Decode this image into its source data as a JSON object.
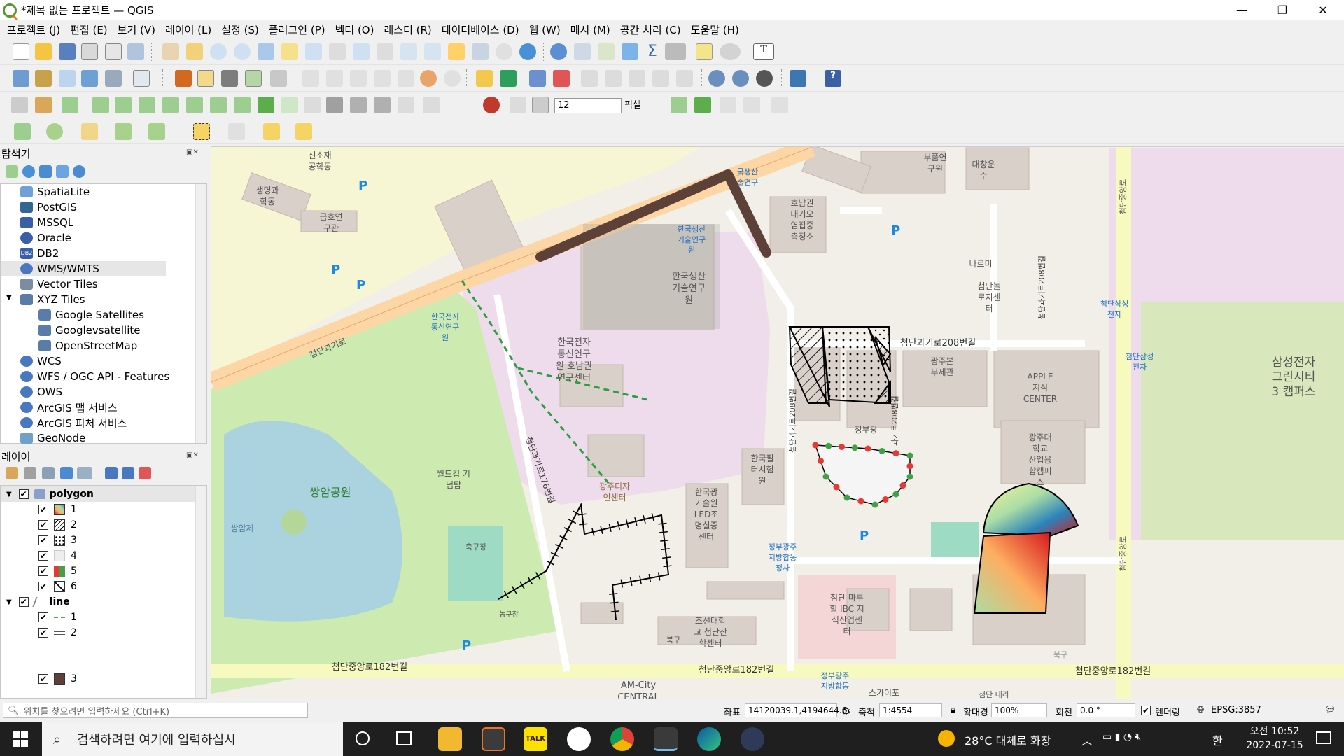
{
  "window": {
    "title": "*제목 없는 프로젝트 — QGIS",
    "minimize": "—",
    "maximize": "❐",
    "close": "✕"
  },
  "menu": [
    "프로젝트 (J)",
    "편집 (E)",
    "보기 (V)",
    "레이어 (L)",
    "설정 (S)",
    "플러그인 (P)",
    "벡터 (O)",
    "래스터 (R)",
    "데이터베이스 (D)",
    "웹 (W)",
    "메시 (M)",
    "공간 처리 (C)",
    "도움말 (H)"
  ],
  "digitize_toolbar": {
    "spin_value": "12",
    "unit": "픽셀"
  },
  "browser_panel": {
    "title": "탐색기",
    "items": [
      "SpatiaLite",
      "PostGIS",
      "MSSQL",
      "Oracle",
      "DB2",
      "WMS/WMTS",
      "Vector Tiles",
      "XYZ Tiles",
      "Google Satellites",
      "Googlevsatellite",
      "OpenStreetMap",
      "WCS",
      "WFS / OGC API - Features",
      "OWS",
      "ArcGIS 맵 서비스",
      "ArcGIS 피처 서비스",
      "GeoNode"
    ],
    "db2_badge": "DB2"
  },
  "layers_panel": {
    "title": "레이어",
    "polygon_layer": "polygon",
    "polygon_classes": [
      "1",
      "2",
      "3",
      "4",
      "5",
      "6"
    ],
    "line_layer": "line",
    "line_classes": [
      "1",
      "2"
    ],
    "extra_class": "3"
  },
  "locator": {
    "placeholder": "위치를 찾으려면 입력하세요 (Ctrl+K)"
  },
  "status": {
    "coord_label": "좌표",
    "coord_value": "14120039.1,4194644.6",
    "scale_label": "축척",
    "scale_value": "1:4554",
    "magnifier_label": "확대경",
    "magnifier_value": "100%",
    "rotation_label": "회전",
    "rotation_value": "0.0 °",
    "render_label": "렌더링",
    "crs": "EPSG:3857"
  },
  "map_labels": {
    "road_main": "첨단과기로",
    "road_182_left": "첨단중앙로182번길",
    "road_182_mid": "첨단중앙로182번길",
    "road_182_right": "첨단중앙로182번길",
    "road_208": "첨단과기로208번길",
    "road_208_v1": "첨단과기로208번길",
    "road_208_v2": "과기로208번길",
    "road_208_v3": "첨단과기로208번길",
    "road_176": "첨단과기로176번길",
    "road_jungang": "첨단중앙로",
    "road_jungang2": "첨단중앙로",
    "park": "쌍암공원",
    "pond": "쌍암제",
    "etri": "한국전자\n통신연구\n원 호남권\n연구센터",
    "etri_small": "한국전자\n통신연구\n원",
    "kitech": "한국생산\n기술연구\n원",
    "kitech_small": "한국생산\n기술연구\n원",
    "kitech_top": "국생산\n술연구",
    "samsung": "삼성전자\n그린시티\n3 캠퍼스",
    "samsung_bus1": "첨단삼성\n전자",
    "samsung_bus2": "첨단삼성\n전자",
    "apple": "APPLE\n지식\nCENTER",
    "gwangju_univ": "광주대\n학교\n산업용\n합캠퍼\n스",
    "gwangju_bon": "광주본\n부세관",
    "nano": "나르미",
    "nano2": "첨단놀\n로지센\n터",
    "honam_air": "호남권\n대기오\n염집중\n측정소",
    "daechang": "대창운\n수",
    "bupum": "부품연\n구원",
    "test_lab": "한국필\n터시험\n원",
    "led": "한국광\n기술원\nLED조\n명실증\n센터",
    "gov": "정부광주\n지방합동\n청사",
    "gov2": "정부광주\n지방합동",
    "gov_small": "정부광",
    "chosun": "조선대학\n교 첨단산\n학센터",
    "ibc": "첨단 마루\n힐 IBC 지\n식산업센\n터",
    "design": "광주디자\n인센터",
    "worldcup": "월드컵 기\n념탑",
    "soccer": "축구장",
    "basket": "농구장",
    "life": "생명과\n학동",
    "kumho": "금호연\n구관",
    "material": "신소재\n공학동",
    "amcity": "AM-City\nCENTRAL",
    "skaipo": "스카이포",
    "cheomdan_daera": "첨단 대라",
    "bukgu": "북구",
    "bukgu2": "북구",
    "parking": "P"
  },
  "taskbar": {
    "search_placeholder": "검색하려면 여기에 입력하십시",
    "weather": "28°C  대체로 화창",
    "ime": "한",
    "time": "오전 10:52",
    "date": "2022-07-15"
  }
}
